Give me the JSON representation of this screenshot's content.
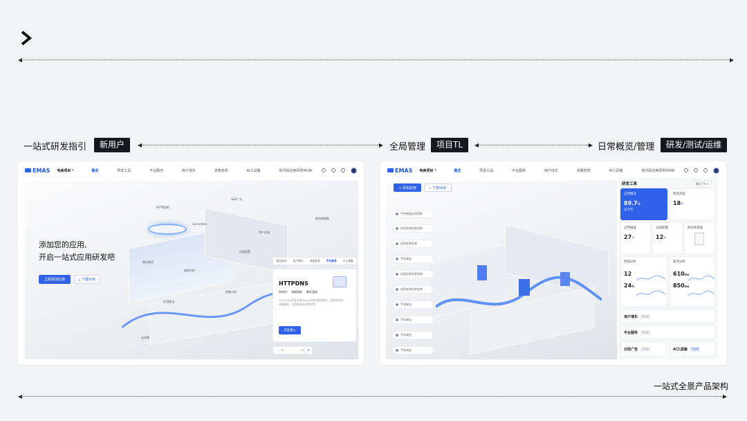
{
  "header": {
    "arrow_glyph": ">"
  },
  "sections": {
    "guide": {
      "label": "一站式研发指引",
      "tag": "新用户"
    },
    "overview": {
      "label": "全局管理",
      "tag": "项目TL"
    },
    "daily": {
      "label": "日常概览/管理",
      "tag": "研发/测试/运维"
    }
  },
  "footer": {
    "caption": "一站式全景产品架构"
  },
  "screen1": {
    "logo": "EMAS",
    "project": "电商项目",
    "nav": [
      "概览",
      "研发工具",
      "平台服务",
      "用户增长",
      "流量变现",
      "AI工具箱",
      "低代码应用研发MOBI"
    ],
    "headline1": "添加您的应用,",
    "headline2": "开启一站式应用研发吧",
    "btn_add": "立即添加应用",
    "btn_sdk": "下载SDK",
    "labels": {
      "httpdns": "HTTPDNS",
      "serverless": "Serverless",
      "ad": "云码广告",
      "mobile_test": "移动测试",
      "crash": "崩溃分析",
      "push": "应用推送",
      "perf": "性能分析",
      "ctrl": "远程配置",
      "feedback": "用户反馈",
      "hotfix": "移动热修复",
      "tablet": "云构建"
    },
    "product_tabs": [
      "移动测试",
      "用户增长",
      "流量变现",
      "平台服务",
      "AI工具箱"
    ],
    "product": {
      "title": "HTTPDNS",
      "subtitle_items": [
        "防劫持",
        "调度精准",
        "解析速度"
      ],
      "desc": "HTTPDNS是面向移动App的域名解析服务，具有防劫持、调度精准、实时解析生效等特性。",
      "btn": "点击进入"
    },
    "controls": [
      "←",
      "→",
      "✕"
    ]
  },
  "screen2": {
    "logo": "EMAS",
    "project": "电商项目",
    "nav": [
      "概览",
      "研发工具",
      "平台服务",
      "用户增长",
      "流量变现",
      "AI工具箱",
      "低代码应用研发MOBI"
    ],
    "btn_add": "+ 添加应用",
    "btn_sdk": "下载SDK",
    "apps": [
      "平台框架应用名称",
      "应用名称名称名称",
      "应用名称名称",
      "手机淘宝",
      "应用名称名称名称",
      "应用名称名称名称",
      "手机淘宝",
      "手机淘宝",
      "手机淘宝",
      "手机淘宝"
    ],
    "panel_title": "研发工具",
    "panel_select": "最近7天",
    "metrics": {
      "m1": {
        "title": "应用概况",
        "value": "89.7",
        "unit": "%",
        "note": "崩溃率"
      },
      "m2": {
        "title": "移动测试",
        "value": "18",
        "unit": "个"
      },
      "m3": {
        "title": "应用推送",
        "value": "27",
        "unit": "个"
      },
      "m4": {
        "title": "远程配置",
        "value": "12",
        "unit": "个"
      },
      "m5": {
        "title": "移动热修复"
      },
      "m6": {
        "title": "性能分析",
        "v1": "12",
        "v2": "24",
        "unit2": "%"
      },
      "m7": {
        "title": "崩溃分析",
        "v1": "610",
        "unit1": "ms",
        "v2": "850",
        "unit2": "ms"
      }
    },
    "rows": [
      {
        "name": "用户增长",
        "badge": "未启用"
      },
      {
        "name": "平台服务",
        "badge": "未启用"
      },
      {
        "name": "云码广告",
        "badge": "未启用"
      },
      {
        "name": "AI工具箱",
        "badge": "已启用"
      }
    ]
  }
}
